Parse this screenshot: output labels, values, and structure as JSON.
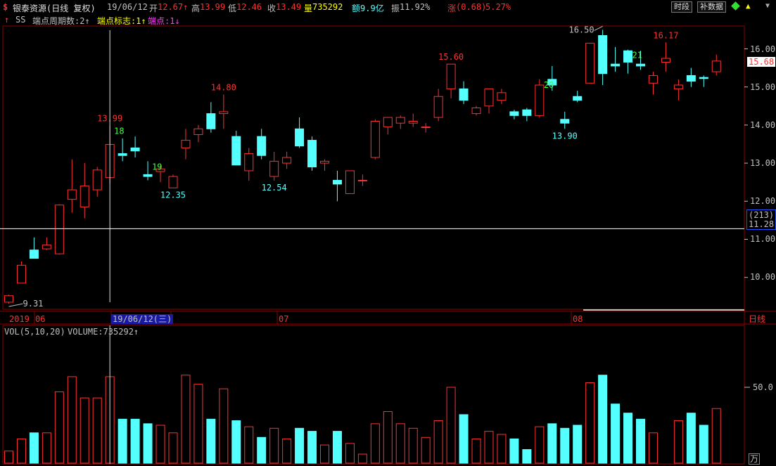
{
  "header": {
    "logo_glyph": "$",
    "title": "银泰资源(日线 复权)",
    "date": "19/06/12",
    "open_label": "开",
    "open_value": "12.67↑",
    "high_label": "高",
    "high_value": "13.99",
    "low_label": "低",
    "low_value": "12.46",
    "close_label": "收",
    "close_value": "13.49",
    "volume_label": "量",
    "volume_value": "735292",
    "amount_label": "额",
    "amount_value": "9.9亿",
    "amplitude_label": "振",
    "amplitude_value": "11.92%",
    "change_label": "涨",
    "change_value": "(0.68)",
    "change_pct": "5.27%",
    "btn_timeshare": "时段",
    "btn_supplement": "补数据"
  },
  "indicator_line": {
    "name": "SS",
    "param1": "端点周期数:2↑",
    "param2": "端点标志:1↑",
    "param3": "端点:1↓"
  },
  "volume_header": {
    "label": "VOL(5,10,20)",
    "volume": "VOLUME:735292↑"
  },
  "timeline": {
    "labels": [
      "2019",
      "06",
      "19/06/12(三)",
      "07",
      "08"
    ],
    "period_button": "日线"
  },
  "axis": {
    "price_ticks": [
      "16.00",
      "15.00",
      "14.00",
      "13.00",
      "12.00",
      "11.00",
      "10.00"
    ],
    "current_price": "15.68",
    "cursor_count": "(213)",
    "cursor_price": "11.28",
    "volume_tick": "50.0",
    "volume_unit": "万"
  },
  "colors": {
    "up": "#ff3030",
    "down": "#54ffff",
    "background": "#000000",
    "grid": "#8b0000",
    "text": "#c0c0c0",
    "header_yellow": "#ffff00",
    "label_green": "#40ff40",
    "label_magenta": "#ff40ff"
  },
  "chart_data": {
    "type": "candlestick",
    "price_range": [
      9.2,
      16.7
    ],
    "volume_range": [
      0,
      85
    ],
    "cursor_price": 11.28,
    "cursor_date": "19/06/12",
    "candles": [
      {
        "o": 9.35,
        "h": 9.55,
        "l": 9.31,
        "c": 9.52,
        "v": 8
      },
      {
        "o": 9.85,
        "h": 10.42,
        "l": 9.85,
        "c": 10.32,
        "v": 16
      },
      {
        "o": 10.72,
        "h": 11.05,
        "l": 10.55,
        "c": 10.5,
        "v": 20
      },
      {
        "o": 10.75,
        "h": 11.05,
        "l": 10.72,
        "c": 10.85,
        "v": 20
      },
      {
        "o": 10.62,
        "h": 11.92,
        "l": 10.6,
        "c": 11.9,
        "v": 47
      },
      {
        "o": 12.05,
        "h": 13.1,
        "l": 11.7,
        "c": 12.3,
        "v": 57
      },
      {
        "o": 11.85,
        "h": 13.0,
        "l": 11.55,
        "c": 12.4,
        "v": 43
      },
      {
        "o": 12.3,
        "h": 12.9,
        "l": 12.12,
        "c": 12.82,
        "v": 43
      },
      {
        "o": 12.62,
        "h": 13.99,
        "l": 12.46,
        "c": 13.49,
        "v": 57
      },
      {
        "o": 13.25,
        "h": 13.65,
        "l": 13.05,
        "c": 13.2,
        "v": 29
      },
      {
        "o": 13.4,
        "h": 13.7,
        "l": 13.15,
        "c": 13.32,
        "v": 29
      },
      {
        "o": 12.7,
        "h": 13.05,
        "l": 12.55,
        "c": 12.65,
        "v": 26
      },
      {
        "o": 12.78,
        "h": 12.95,
        "l": 12.5,
        "c": 12.85,
        "v": 25
      },
      {
        "o": 12.35,
        "h": 12.7,
        "l": 12.35,
        "c": 12.65,
        "v": 20
      },
      {
        "o": 13.4,
        "h": 13.9,
        "l": 13.1,
        "c": 13.6,
        "v": 58
      },
      {
        "o": 13.75,
        "h": 14.0,
        "l": 13.55,
        "c": 13.9,
        "v": 52
      },
      {
        "o": 14.3,
        "h": 14.6,
        "l": 13.8,
        "c": 13.9,
        "v": 29
      },
      {
        "o": 14.3,
        "h": 14.8,
        "l": 13.9,
        "c": 14.35,
        "v": 49
      },
      {
        "o": 13.7,
        "h": 13.85,
        "l": 12.95,
        "c": 12.95,
        "v": 28
      },
      {
        "o": 12.8,
        "h": 13.4,
        "l": 12.54,
        "c": 13.25,
        "v": 24
      },
      {
        "o": 13.7,
        "h": 13.9,
        "l": 13.1,
        "c": 13.2,
        "v": 17
      },
      {
        "o": 12.65,
        "h": 13.3,
        "l": 12.54,
        "c": 13.05,
        "v": 23
      },
      {
        "o": 13.0,
        "h": 13.3,
        "l": 12.85,
        "c": 13.15,
        "v": 16
      },
      {
        "o": 13.9,
        "h": 14.2,
        "l": 13.4,
        "c": 13.45,
        "v": 23
      },
      {
        "o": 13.6,
        "h": 13.7,
        "l": 12.8,
        "c": 12.9,
        "v": 21
      },
      {
        "o": 13.0,
        "h": 13.1,
        "l": 12.8,
        "c": 13.05,
        "v": 12
      },
      {
        "o": 12.55,
        "h": 12.8,
        "l": 12.0,
        "c": 12.45,
        "v": 21
      },
      {
        "o": 12.2,
        "h": 12.8,
        "l": 12.2,
        "c": 12.8,
        "v": 13
      },
      {
        "o": 12.55,
        "h": 12.7,
        "l": 12.4,
        "c": 12.55,
        "v": 6
      },
      {
        "o": 13.15,
        "h": 14.15,
        "l": 13.1,
        "c": 14.1,
        "v": 26
      },
      {
        "o": 13.95,
        "h": 14.2,
        "l": 13.75,
        "c": 14.2,
        "v": 34
      },
      {
        "o": 14.05,
        "h": 14.25,
        "l": 13.9,
        "c": 14.2,
        "v": 26
      },
      {
        "o": 14.05,
        "h": 14.3,
        "l": 13.95,
        "c": 14.1,
        "v": 23
      },
      {
        "o": 13.95,
        "h": 14.05,
        "l": 13.8,
        "c": 13.95,
        "v": 17
      },
      {
        "o": 14.2,
        "h": 14.95,
        "l": 14.1,
        "c": 14.75,
        "v": 28
      },
      {
        "o": 14.95,
        "h": 15.6,
        "l": 14.7,
        "c": 15.6,
        "v": 50
      },
      {
        "o": 14.95,
        "h": 15.15,
        "l": 14.55,
        "c": 14.65,
        "v": 32
      },
      {
        "o": 14.3,
        "h": 14.5,
        "l": 14.25,
        "c": 14.45,
        "v": 16
      },
      {
        "o": 14.5,
        "h": 14.95,
        "l": 14.3,
        "c": 14.95,
        "v": 21
      },
      {
        "o": 14.65,
        "h": 14.95,
        "l": 14.55,
        "c": 14.85,
        "v": 19
      },
      {
        "o": 14.35,
        "h": 14.4,
        "l": 14.15,
        "c": 14.25,
        "v": 16
      },
      {
        "o": 14.4,
        "h": 14.45,
        "l": 14.1,
        "c": 14.25,
        "v": 9
      },
      {
        "o": 14.25,
        "h": 15.2,
        "l": 14.2,
        "c": 15.05,
        "v": 24
      },
      {
        "o": 15.2,
        "h": 15.55,
        "l": 14.9,
        "c": 15.05,
        "v": 26
      },
      {
        "o": 14.15,
        "h": 14.35,
        "l": 13.9,
        "c": 14.05,
        "v": 23
      },
      {
        "o": 14.75,
        "h": 14.9,
        "l": 14.6,
        "c": 14.65,
        "v": 25
      },
      {
        "o": 15.1,
        "h": 16.15,
        "l": 15.1,
        "c": 16.15,
        "v": 53
      },
      {
        "o": 16.35,
        "h": 16.5,
        "l": 15.05,
        "c": 15.35,
        "v": 58
      },
      {
        "o": 15.6,
        "h": 16.05,
        "l": 15.4,
        "c": 15.55,
        "v": 39
      },
      {
        "o": 15.95,
        "h": 15.98,
        "l": 15.35,
        "c": 15.65,
        "v": 33
      },
      {
        "o": 15.6,
        "h": 15.95,
        "l": 15.45,
        "c": 15.55,
        "v": 29
      },
      {
        "o": 15.1,
        "h": 15.4,
        "l": 14.8,
        "c": 15.3,
        "v": 20
      },
      {
        "o": 15.65,
        "h": 16.17,
        "l": 15.4,
        "c": 15.75,
        "v": 0
      },
      {
        "o": 14.95,
        "h": 15.2,
        "l": 14.65,
        "c": 15.05,
        "v": 28
      },
      {
        "o": 15.3,
        "h": 15.5,
        "l": 15.0,
        "c": 15.15,
        "v": 33
      },
      {
        "o": 15.25,
        "h": 15.3,
        "l": 15.0,
        "c": 15.22,
        "v": 25
      },
      {
        "o": 15.4,
        "h": 15.85,
        "l": 15.3,
        "c": 15.68,
        "v": 36
      }
    ],
    "price_annotations": [
      {
        "text": "9.31",
        "kind": "low",
        "index": 0
      },
      {
        "text": "13.99",
        "kind": "high",
        "index": 8
      },
      {
        "text": "18",
        "kind": "count",
        "index": 8
      },
      {
        "text": "19",
        "kind": "count",
        "index": 11
      },
      {
        "text": "12.35",
        "kind": "low",
        "index": 13
      },
      {
        "text": "14.80",
        "kind": "high",
        "index": 17
      },
      {
        "text": "12.54",
        "kind": "low",
        "index": 21
      },
      {
        "text": "15.60",
        "kind": "high",
        "index": 35
      },
      {
        "text": "20",
        "kind": "count",
        "index": 42
      },
      {
        "text": "13.90",
        "kind": "low",
        "index": 44
      },
      {
        "text": "16.50",
        "kind": "high",
        "index": 47
      },
      {
        "text": "21",
        "kind": "count",
        "index": 49
      },
      {
        "text": "16.17",
        "kind": "high",
        "index": 52
      }
    ]
  }
}
